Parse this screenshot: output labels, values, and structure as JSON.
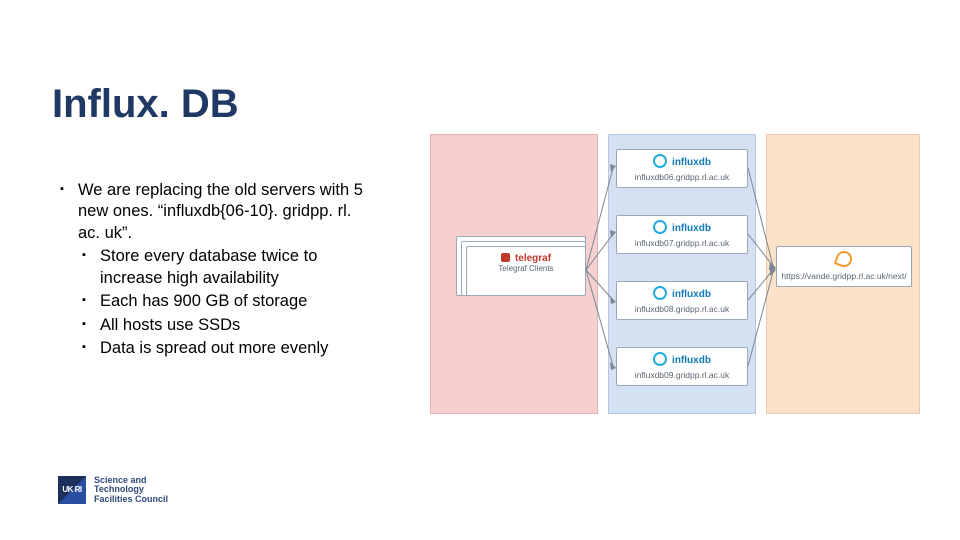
{
  "title": "Influx. DB",
  "bullets": {
    "main": "We are replacing the old servers with 5 new ones. “influxdb{06-10}. gridpp. rl. ac. uk”.",
    "sub1": "Store every database twice to increase high availability",
    "sub2": "Each has 900 GB of storage",
    "sub3": "All hosts use SSDs",
    "sub4": "Data is spread out more evenly"
  },
  "diagram": {
    "telegraf_brand": "telegraf",
    "telegraf_label": "Telegraf Clients",
    "influx_brand": "influxdb",
    "nodes": {
      "n06": "influxdb06.gridpp.rl.ac.uk",
      "n07": "influxdb07.gridpp.rl.ac.uk",
      "n08": "influxdb08.gridpp.rl.ac.uk",
      "n09": "influxdb09.gridpp.rl.ac.uk"
    },
    "grafana_url": "https://vande.gridpp.rl.ac.uk/next/"
  },
  "footer": {
    "ukri": "UK RI",
    "stfc_line1": "Science and",
    "stfc_line2": "Technology",
    "stfc_line3": "Facilities Council"
  }
}
